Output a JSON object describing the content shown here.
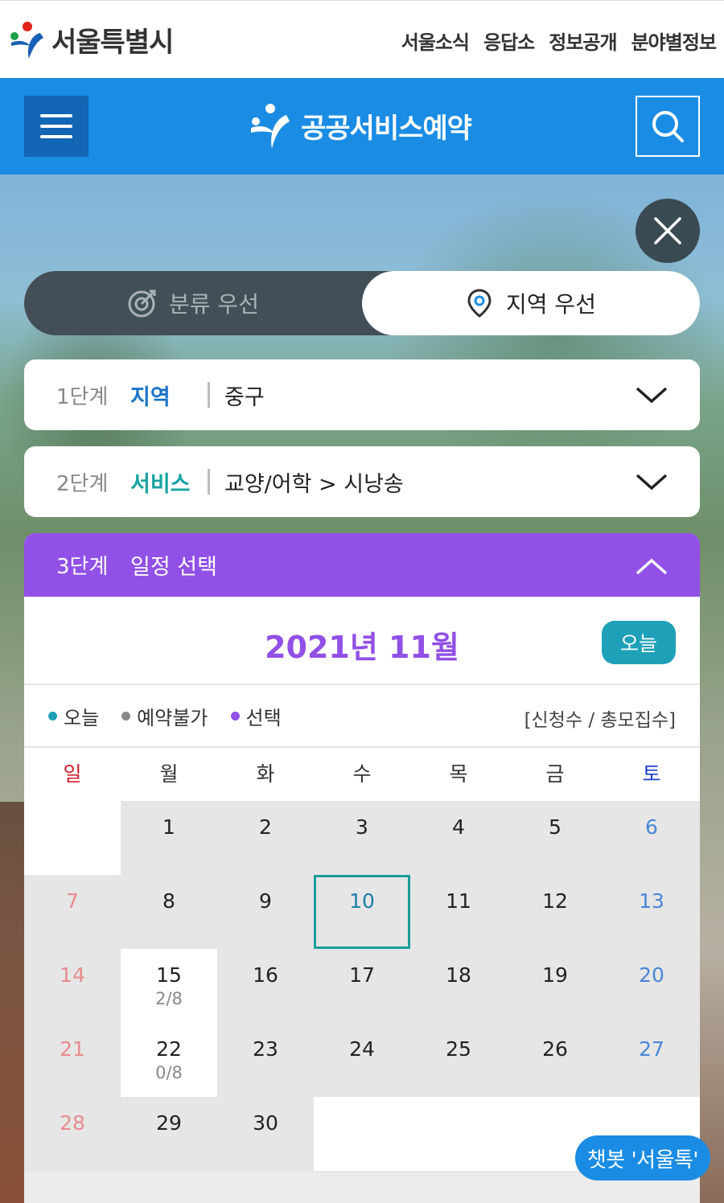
{
  "header": {
    "logo_text": "서울특별시",
    "nav": [
      "서울소식",
      "응답소",
      "정보공개",
      "분야별정보"
    ]
  },
  "bar": {
    "brand": "공공서비스예약"
  },
  "toggle": {
    "left_label": "분류 우선",
    "right_label": "지역 우선",
    "selected": "지역 우선"
  },
  "steps": {
    "step1": {
      "num": "1단계",
      "key": "지역",
      "value": "중구"
    },
    "step2": {
      "num": "2단계",
      "key": "서비스",
      "value": "교양/어학 > 시낭송"
    },
    "step3": {
      "num": "3단계",
      "key": "일정 선택"
    }
  },
  "calendar": {
    "month_title": "2021년 11월",
    "today_button": "오늘",
    "legend": [
      {
        "label": "오늘",
        "color": "#1da0b8"
      },
      {
        "label": "예약불가",
        "color": "#888888"
      },
      {
        "label": "선택",
        "color": "#9150e6"
      }
    ],
    "legend_note": "[신청수 / 총모집수]",
    "weekdays": [
      "일",
      "월",
      "화",
      "수",
      "목",
      "금",
      "토"
    ],
    "days": [
      {
        "d": "",
        "sub": ""
      },
      {
        "d": "1",
        "sub": ""
      },
      {
        "d": "2",
        "sub": ""
      },
      {
        "d": "3",
        "sub": ""
      },
      {
        "d": "4",
        "sub": ""
      },
      {
        "d": "5",
        "sub": ""
      },
      {
        "d": "6",
        "sub": ""
      },
      {
        "d": "7",
        "sub": ""
      },
      {
        "d": "8",
        "sub": ""
      },
      {
        "d": "9",
        "sub": ""
      },
      {
        "d": "10",
        "sub": ""
      },
      {
        "d": "11",
        "sub": ""
      },
      {
        "d": "12",
        "sub": ""
      },
      {
        "d": "13",
        "sub": ""
      },
      {
        "d": "14",
        "sub": ""
      },
      {
        "d": "15",
        "sub": "2/8"
      },
      {
        "d": "16",
        "sub": ""
      },
      {
        "d": "17",
        "sub": ""
      },
      {
        "d": "18",
        "sub": ""
      },
      {
        "d": "19",
        "sub": ""
      },
      {
        "d": "20",
        "sub": ""
      },
      {
        "d": "21",
        "sub": ""
      },
      {
        "d": "22",
        "sub": "0/8"
      },
      {
        "d": "23",
        "sub": ""
      },
      {
        "d": "24",
        "sub": ""
      },
      {
        "d": "25",
        "sub": ""
      },
      {
        "d": "26",
        "sub": ""
      },
      {
        "d": "27",
        "sub": ""
      },
      {
        "d": "28",
        "sub": ""
      },
      {
        "d": "29",
        "sub": ""
      },
      {
        "d": "30",
        "sub": ""
      },
      {
        "d": "",
        "sub": ""
      },
      {
        "d": "",
        "sub": ""
      },
      {
        "d": "",
        "sub": ""
      },
      {
        "d": "",
        "sub": ""
      }
    ],
    "today": "10",
    "available": [
      "15",
      "22"
    ]
  },
  "chatbot": {
    "label": "챗봇 '서울톡'"
  },
  "icons": {
    "menu": "hamburger-icon",
    "search": "search-icon",
    "close": "close-icon",
    "category": "target-icon",
    "location": "location-pin-icon"
  }
}
